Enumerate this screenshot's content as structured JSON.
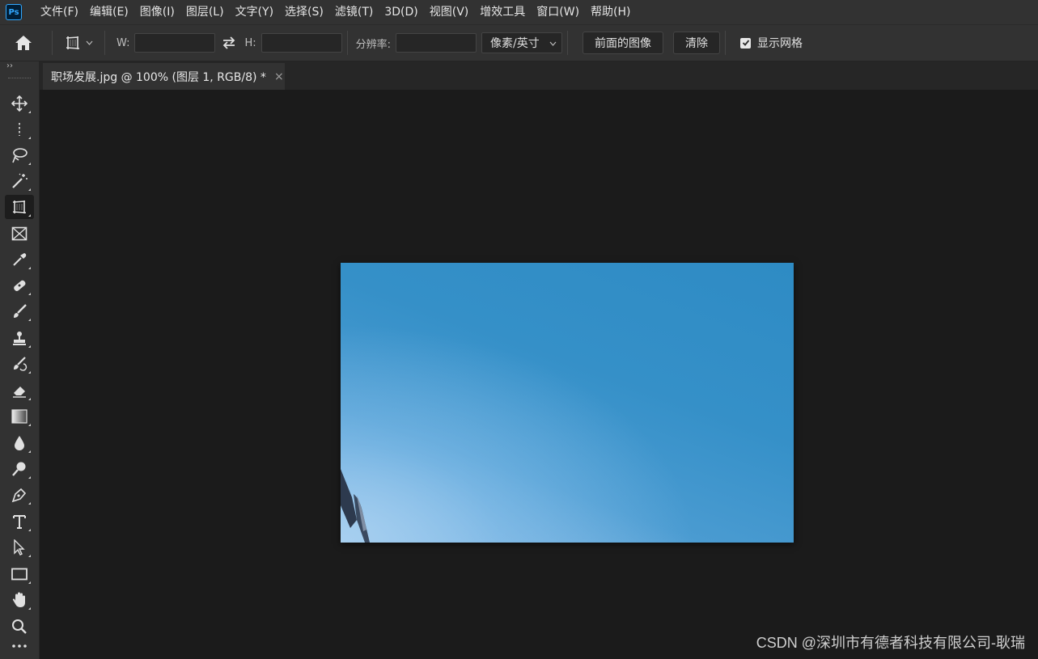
{
  "app": {
    "logo_text": "Ps"
  },
  "menu": {
    "items": [
      "文件(F)",
      "编辑(E)",
      "图像(I)",
      "图层(L)",
      "文字(Y)",
      "选择(S)",
      "滤镜(T)",
      "3D(D)",
      "视图(V)",
      "增效工具",
      "窗口(W)",
      "帮助(H)"
    ]
  },
  "options": {
    "width_label": "W:",
    "width_value": "",
    "height_label": "H:",
    "height_value": "",
    "resolution_label": "分辨率:",
    "resolution_value": "",
    "unit_selected": "像素/英寸",
    "front_image_label": "前面的图像",
    "clear_label": "清除",
    "show_grid_label": "显示网格",
    "show_grid_checked": true
  },
  "toolbar": {
    "collapse_glyph": "››",
    "active_tool": "perspective-crop-tool",
    "tools": [
      "move-tool",
      "marquee-tool",
      "lasso-tool",
      "magic-wand-tool",
      "perspective-crop-tool",
      "frame-tool",
      "eyedropper-tool",
      "healing-brush-tool",
      "brush-tool",
      "clone-stamp-tool",
      "history-brush-tool",
      "eraser-tool",
      "gradient-tool",
      "blur-tool",
      "dodge-tool",
      "pen-tool",
      "type-tool",
      "path-selection-tool",
      "rectangle-tool",
      "hand-tool",
      "zoom-tool",
      "more-tools"
    ]
  },
  "document": {
    "tab_title": "职场发展.jpg @ 100% (图层 1, RGB/8) *",
    "close_glyph": "×"
  },
  "watermark": "CSDN @深圳市有德者科技有限公司-耿瑞",
  "colors": {
    "chrome": "#323232",
    "canvas_bg": "#1b1b1b",
    "accent": "#31a8ff",
    "sky": "#2e8bc4"
  }
}
